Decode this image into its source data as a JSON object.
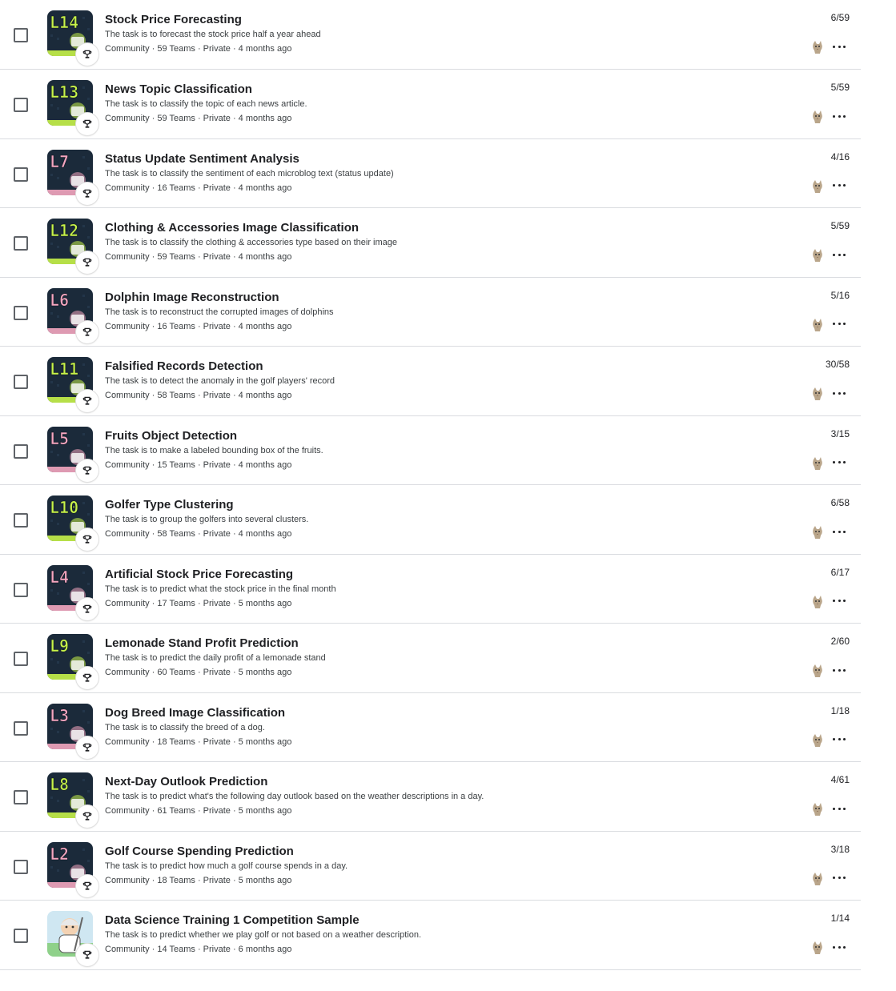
{
  "competitions": [
    {
      "level": "L14",
      "title": "Stock Price Forecasting",
      "description": "The task is to forecast the stock price half a year ahead",
      "meta": "Community · 59 Teams · Private · 4 months ago",
      "rank": "6/59",
      "thumb_bg": "#1b2a3a",
      "accent": "#c8f34a",
      "icon": "stock-chart-icon"
    },
    {
      "level": "L13",
      "title": "News Topic Classification",
      "description": "The task is to classify the topic of each news article.",
      "meta": "Community · 59 Teams · Private · 4 months ago",
      "rank": "5/59",
      "thumb_bg": "#1b2a3a",
      "accent": "#c8f34a",
      "icon": "newspaper-icon"
    },
    {
      "level": "L7",
      "title": "Status Update Sentiment Analysis",
      "description": "The task is to classify the sentiment of each microblog text (status update)",
      "meta": "Community · 16 Teams · Private · 4 months ago",
      "rank": "4/16",
      "thumb_bg": "#1b2a3a",
      "accent": "#f4a6c0",
      "icon": "megaphone-icon"
    },
    {
      "level": "L12",
      "title": "Clothing & Accessories Image Classification",
      "description": "The task is to classify the clothing & accessories type based on their image",
      "meta": "Community · 59 Teams · Private · 4 months ago",
      "rank": "5/59",
      "thumb_bg": "#1b2a3a",
      "accent": "#c8f34a",
      "icon": "clothing-icon"
    },
    {
      "level": "L6",
      "title": "Dolphin Image Reconstruction",
      "description": "The task is to reconstruct the corrupted images of dolphins",
      "meta": "Community · 16 Teams · Private · 4 months ago",
      "rank": "5/16",
      "thumb_bg": "#1b2a3a",
      "accent": "#f4a6c0",
      "icon": "dolphin-icon"
    },
    {
      "level": "L11",
      "title": "Falsified Records Detection",
      "description": "The task is to detect the anomaly in the golf players' record",
      "meta": "Community · 58 Teams · Private · 4 months ago",
      "rank": "30/58",
      "thumb_bg": "#1b2a3a",
      "accent": "#c8f34a",
      "icon": "record-icon"
    },
    {
      "level": "L5",
      "title": "Fruits Object Detection",
      "description": "The task is to make a labeled bounding box of the fruits.",
      "meta": "Community · 15 Teams · Private · 4 months ago",
      "rank": "3/15",
      "thumb_bg": "#1b2a3a",
      "accent": "#f4a6c0",
      "icon": "apple-icon"
    },
    {
      "level": "L10",
      "title": "Golfer Type Clustering",
      "description": "The task is to group the golfers into several clusters.",
      "meta": "Community · 58 Teams · Private · 4 months ago",
      "rank": "6/58",
      "thumb_bg": "#1b2a3a",
      "accent": "#c8f34a",
      "icon": "golfer-icon"
    },
    {
      "level": "L4",
      "title": "Artificial Stock Price Forecasting",
      "description": "The task is to predict what the stock price in the final month",
      "meta": "Community · 17 Teams · Private · 5 months ago",
      "rank": "6/17",
      "thumb_bg": "#1b2a3a",
      "accent": "#f4a6c0",
      "icon": "bar-chart-icon"
    },
    {
      "level": "L9",
      "title": "Lemonade Stand Profit Prediction",
      "description": "The task is to predict the daily profit of a lemonade stand",
      "meta": "Community · 60 Teams · Private · 5 months ago",
      "rank": "2/60",
      "thumb_bg": "#1b2a3a",
      "accent": "#c8f34a",
      "icon": "lemonade-icon"
    },
    {
      "level": "L3",
      "title": "Dog Breed Image Classification",
      "description": "The task is to classify the breed of a dog.",
      "meta": "Community · 18 Teams · Private · 5 months ago",
      "rank": "1/18",
      "thumb_bg": "#1b2a3a",
      "accent": "#f4a6c0",
      "icon": "dog-icon"
    },
    {
      "level": "L8",
      "title": "Next-Day Outlook Prediction",
      "description": "The task is to predict what's the following day outlook based on the weather descriptions in a day.",
      "meta": "Community · 61 Teams · Private · 5 months ago",
      "rank": "4/61",
      "thumb_bg": "#1b2a3a",
      "accent": "#c8f34a",
      "icon": "weather-icon"
    },
    {
      "level": "L2",
      "title": "Golf Course Spending Prediction",
      "description": "The task is to predict how much a golf course spends in a day.",
      "meta": "Community · 18 Teams · Private · 5 months ago",
      "rank": "3/18",
      "thumb_bg": "#1b2a3a",
      "accent": "#f4a6c0",
      "icon": "golf-bag-icon"
    },
    {
      "level": "",
      "title": "Data Science Training 1 Competition Sample",
      "description": "The task is to predict whether we play golf or not based on a weather description.",
      "meta": "Community · 14 Teams · Private · 6 months ago",
      "rank": "1/14",
      "thumb_bg": "#cfe7f2",
      "accent": "#7cc3e0",
      "icon": "golf-player-icon"
    }
  ],
  "colors": {
    "divider": "#dadce0",
    "text_primary": "#202124",
    "text_secondary": "#3c4043",
    "checkbox_border": "#5f6368"
  }
}
